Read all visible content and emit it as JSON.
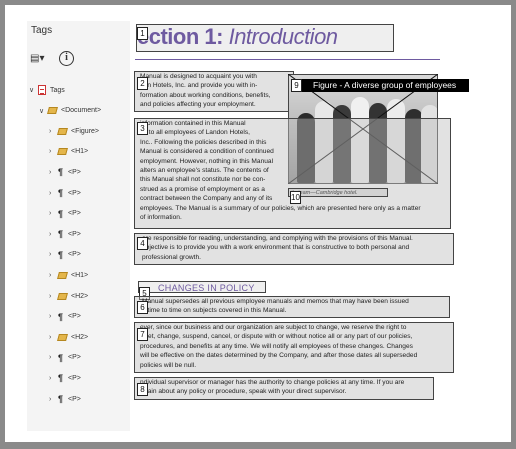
{
  "panel": {
    "title": "Tags",
    "toolbar": {
      "options_icon": "list-options-icon",
      "info_icon": "info-icon",
      "info_glyph": "i"
    },
    "tree": [
      {
        "label": "Tags",
        "kind": "root",
        "expanded": true
      },
      {
        "label": "<Document>",
        "kind": "tag",
        "expanded": true
      },
      {
        "label": "<Figure>",
        "kind": "tag"
      },
      {
        "label": "<H1>",
        "kind": "tag"
      },
      {
        "label": "<P>",
        "kind": "para"
      },
      {
        "label": "<P>",
        "kind": "para"
      },
      {
        "label": "<P>",
        "kind": "para"
      },
      {
        "label": "<P>",
        "kind": "para"
      },
      {
        "label": "<P>",
        "kind": "para"
      },
      {
        "label": "<H1>",
        "kind": "tag"
      },
      {
        "label": "<H2>",
        "kind": "tag"
      },
      {
        "label": "<P>",
        "kind": "para"
      },
      {
        "label": "<H2>",
        "kind": "tag"
      },
      {
        "label": "<P>",
        "kind": "para"
      },
      {
        "label": "<P>",
        "kind": "para"
      },
      {
        "label": "<P>",
        "kind": "para"
      }
    ]
  },
  "document": {
    "heading_main": "ection 1: ",
    "heading_italic": "Introduction",
    "figure_caption_tag": "Figure - A diverse group of employees",
    "photo_caption": "ity team—Cambridge hotel.",
    "subheading": "CHANGES IN POLICY",
    "tag_numbers": [
      "1",
      "2",
      "3",
      "4",
      "5",
      "6",
      "7",
      "8",
      "9",
      "10"
    ],
    "p1": "Manual is designed to acquaint you with\ndon Hotels, Inc. and provide you with in-\nformation about working conditions, benefits,\nand policies affecting your employment.",
    "p2": "information contained in this Manual\nes to all employees of Landon Hotels,\nInc.. Following the policies described in this\nManual is considered a condition of continued\nemployment. However, nothing in this Manual\nalters an employee's status. The contents of\nthis Manual shall not constitute nor be con-\nstrued as a promise of employment or as a\ncontract between the Company and any of its\nemployees. The Manual is a summary of our policies, which are presented here only as a matter\nof information.",
    "p3": "are responsible for reading, understanding, and complying with the provisions of this Manual.\nobjective is to provide you with a work environment that is constructive to both personal and\nprofessional growth.",
    "p4": "Manual supersedes all previous employee manuals and memos that may have been issued\nn time to time on subjects covered in this Manual.",
    "p5": "ever, since our business and our organization are subject to change, we reserve the right to\nrpret, change, suspend, cancel, or dispute with or without notice all or any part of our policies,\nprocedures, and benefits at any time. We will notify all employees of these changes. Changes\nwill be effective on the dates determined by the Company, and after those dates all superseded\npolicies will be null.",
    "p6": "ndividual supervisor or manager has the authority to change policies at any time. If you are\nertain about any policy or procedure, speak with your direct supervisor."
  },
  "colors": {
    "accent": "#6e5aa0",
    "overlay": "#bebebe",
    "caption_bg": "#000000"
  }
}
